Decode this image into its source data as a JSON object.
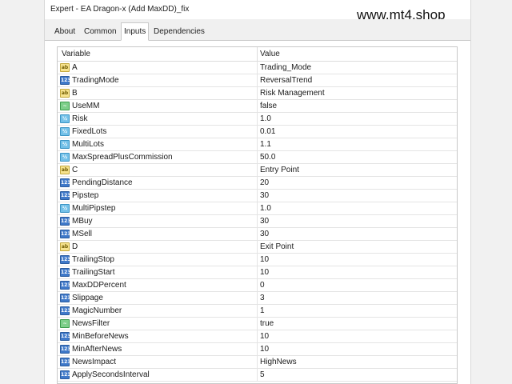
{
  "window": {
    "title": "Expert - EA Dragon-x (Add MaxDD)_fix",
    "watermark": "www.mt4.shop"
  },
  "tabs": [
    {
      "label": "About",
      "active": false
    },
    {
      "label": "Common",
      "active": false
    },
    {
      "label": "Inputs",
      "active": true
    },
    {
      "label": "Dependencies",
      "active": false
    }
  ],
  "table": {
    "headers": {
      "variable": "Variable",
      "value": "Value"
    },
    "rows": [
      {
        "type": "ab",
        "icon_name": "string-type-icon",
        "variable": "A",
        "value": "Trading_Mode"
      },
      {
        "type": "int",
        "icon_name": "integer-type-icon",
        "variable": "TradingMode",
        "value": "ReversalTrend"
      },
      {
        "type": "ab",
        "icon_name": "string-type-icon",
        "variable": "B",
        "value": "Risk Management"
      },
      {
        "type": "bool",
        "icon_name": "boolean-type-icon",
        "variable": "UseMM",
        "value": "false"
      },
      {
        "type": "dbl",
        "icon_name": "double-type-icon",
        "variable": "Risk",
        "value": "1.0"
      },
      {
        "type": "dbl",
        "icon_name": "double-type-icon",
        "variable": "FixedLots",
        "value": "0.01"
      },
      {
        "type": "dbl",
        "icon_name": "double-type-icon",
        "variable": "MultiLots",
        "value": "1.1"
      },
      {
        "type": "dbl",
        "icon_name": "double-type-icon",
        "variable": "MaxSpreadPlusCommission",
        "value": "50.0"
      },
      {
        "type": "ab",
        "icon_name": "string-type-icon",
        "variable": "C",
        "value": "Entry Point"
      },
      {
        "type": "int",
        "icon_name": "integer-type-icon",
        "variable": "PendingDistance",
        "value": "20"
      },
      {
        "type": "int",
        "icon_name": "integer-type-icon",
        "variable": "Pipstep",
        "value": "30"
      },
      {
        "type": "dbl",
        "icon_name": "double-type-icon",
        "variable": "MultiPipstep",
        "value": "1.0"
      },
      {
        "type": "int",
        "icon_name": "integer-type-icon",
        "variable": "MBuy",
        "value": "30"
      },
      {
        "type": "int",
        "icon_name": "integer-type-icon",
        "variable": "MSell",
        "value": "30"
      },
      {
        "type": "ab",
        "icon_name": "string-type-icon",
        "variable": "D",
        "value": "Exit Point"
      },
      {
        "type": "int",
        "icon_name": "integer-type-icon",
        "variable": "TrailingStop",
        "value": "10"
      },
      {
        "type": "int",
        "icon_name": "integer-type-icon",
        "variable": "TrailingStart",
        "value": "10"
      },
      {
        "type": "int",
        "icon_name": "integer-type-icon",
        "variable": "MaxDDPercent",
        "value": "0"
      },
      {
        "type": "int",
        "icon_name": "integer-type-icon",
        "variable": "Slippage",
        "value": "3"
      },
      {
        "type": "int",
        "icon_name": "integer-type-icon",
        "variable": "MagicNumber",
        "value": "1"
      },
      {
        "type": "bool",
        "icon_name": "boolean-type-icon",
        "variable": "NewsFilter",
        "value": "true"
      },
      {
        "type": "int",
        "icon_name": "integer-type-icon",
        "variable": "MinBeforeNews",
        "value": "10"
      },
      {
        "type": "int",
        "icon_name": "integer-type-icon",
        "variable": "MinAfterNews",
        "value": "10"
      },
      {
        "type": "int",
        "icon_name": "integer-type-icon",
        "variable": "NewsImpact",
        "value": "HighNews"
      },
      {
        "type": "int",
        "icon_name": "integer-type-icon",
        "variable": "ApplySecondsInterval",
        "value": "5"
      }
    ]
  },
  "icon_glyphs": {
    "ab": "ab",
    "int": "123",
    "dbl": "½",
    "bool": "~"
  },
  "colors": {
    "string_icon": "#f7e38e",
    "integer_icon": "#3f79c9",
    "double_icon": "#72c0e8",
    "boolean_icon": "#7ecf8a"
  }
}
